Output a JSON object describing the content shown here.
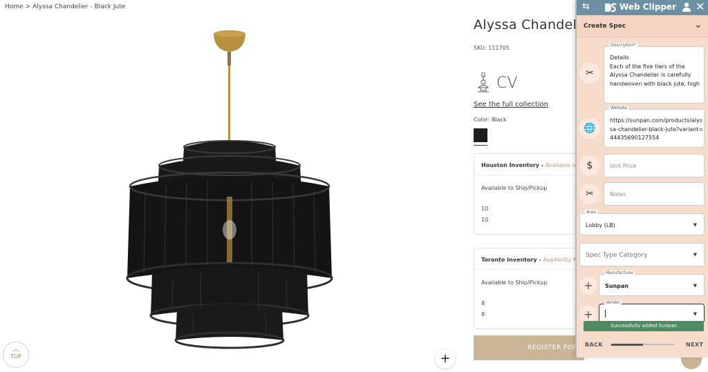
{
  "breadcrumb": {
    "home": "Home",
    "separator": ">",
    "current": "Alyssa Chandelier - Black Jute"
  },
  "top_button": {
    "label": "TOP",
    "icon": "chevron-up-icon"
  },
  "zoom_button": {
    "icon": "plus-icon",
    "glyph": "+"
  },
  "product": {
    "title": "Alyssa Chandelier",
    "sku": "SKU: 111705",
    "brand_text": "CV",
    "collection_link": "See the full collection",
    "color_label": "Color: Black",
    "swatch_color": "#1e1f22"
  },
  "inventory": [
    {
      "location": "Houston Inventory -",
      "availability": "Available on",
      "ship_label": "Available to Ship/Pickup",
      "qty1": "10",
      "qty2": "10"
    },
    {
      "location": "Toronto Inventory -",
      "availability": "Availibility M",
      "ship_label": "Available to Ship/Pickup",
      "qty1": "8",
      "qty2": "8"
    }
  ],
  "register_button": "REGISTER FOR",
  "clipper": {
    "title": "Web Clipper",
    "header_color": "#6b8fa3",
    "section_title": "Create Spec",
    "fields": {
      "description": {
        "label": "Description*",
        "value": "Details\nEach of the five tiers of the Alyssa Chandelier is carefully handwoven with black jute, high"
      },
      "website": {
        "label": "Website",
        "value": "https://sunpan.com/products/alyssa-chandelier-black-jute?variant=44435690127554"
      },
      "unit_price": {
        "placeholder": "Unit Price"
      },
      "notes": {
        "placeholder": "Notes"
      },
      "area": {
        "label": "Area",
        "value": "Lobby (LB)"
      },
      "spec_type": {
        "placeholder": "Spec Type Category"
      },
      "manufacturer": {
        "label": "Manufacturer",
        "value": "Sunpan"
      },
      "vendor": {
        "label": "Vendor",
        "value": ""
      }
    },
    "toast": "Successfully added Sunpan",
    "toast_color": "#4e8a62",
    "nav": {
      "back": "BACK",
      "next": "NEXT",
      "progress": 0.5
    }
  }
}
